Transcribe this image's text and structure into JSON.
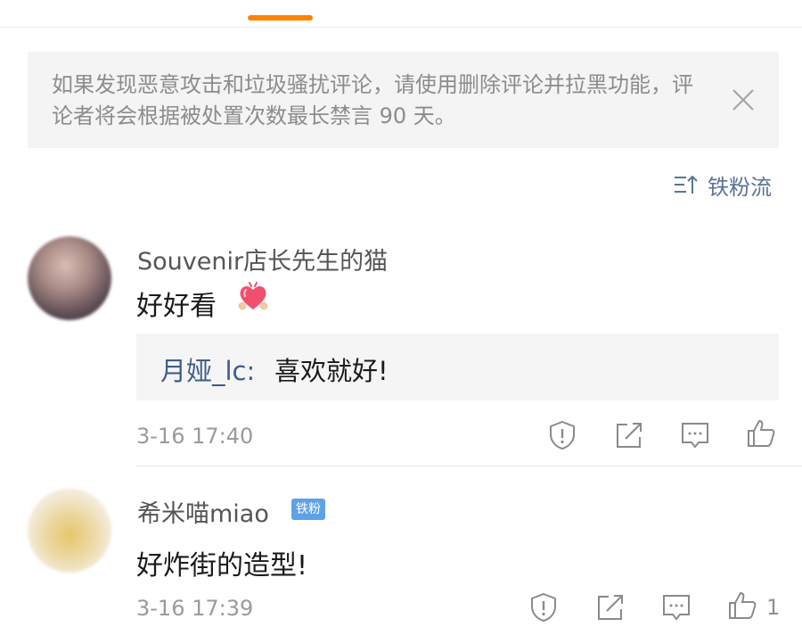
{
  "notice": {
    "text": "如果发现恶意攻击和垃圾骚扰评论，请使用删除评论并拉黑功能，评论者将会根据被处置次数最长禁言 90 天。"
  },
  "sort": {
    "label": "铁粉流"
  },
  "comments": [
    {
      "username": "Souvenir店长先生的猫",
      "text": "好好看",
      "emoji": "heart-emoji",
      "reply": {
        "name": "月娅_lc:",
        "text": "喜欢就好!"
      },
      "timestamp": "3-16 17:40",
      "likes": ""
    },
    {
      "username": "希米喵miao",
      "badge": "铁粉",
      "text": "好炸街的造型!",
      "timestamp": "3-16 17:39",
      "likes": "1"
    }
  ],
  "icons": {
    "report": "report-icon",
    "share": "share-icon",
    "comment": "comment-icon",
    "like": "like-icon",
    "close": "close-icon",
    "sort": "sort-icon"
  },
  "colors": {
    "accent": "#ff8200",
    "link": "#3e5c8c",
    "badge": "#5da2e6"
  }
}
